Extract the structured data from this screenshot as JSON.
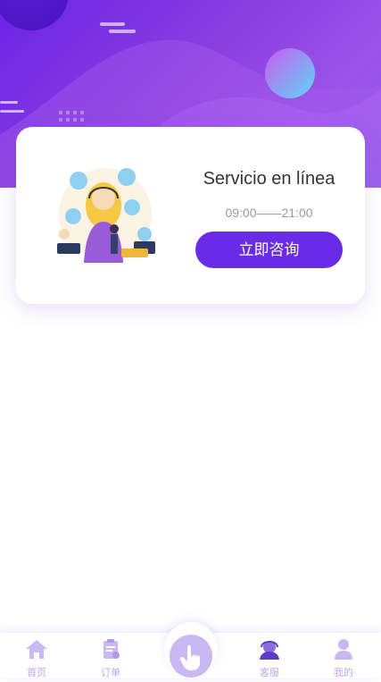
{
  "service": {
    "title": "Servicio en línea",
    "hours": "09:00——21:00",
    "consult_label": "立即咨询"
  },
  "tabbar": {
    "items": [
      {
        "label": "首页",
        "icon": "home-icon"
      },
      {
        "label": "订单",
        "icon": "order-icon"
      },
      {
        "label": "",
        "icon": "tap-hand-icon"
      },
      {
        "label": "客服",
        "icon": "customer-service-icon"
      },
      {
        "label": "我的",
        "icon": "user-icon"
      }
    ]
  },
  "colors": {
    "accent": "#6a2be9",
    "tab_icon": "#c9b8f2",
    "hero_start": "#6a24e6",
    "hero_end": "#9d52ea"
  }
}
